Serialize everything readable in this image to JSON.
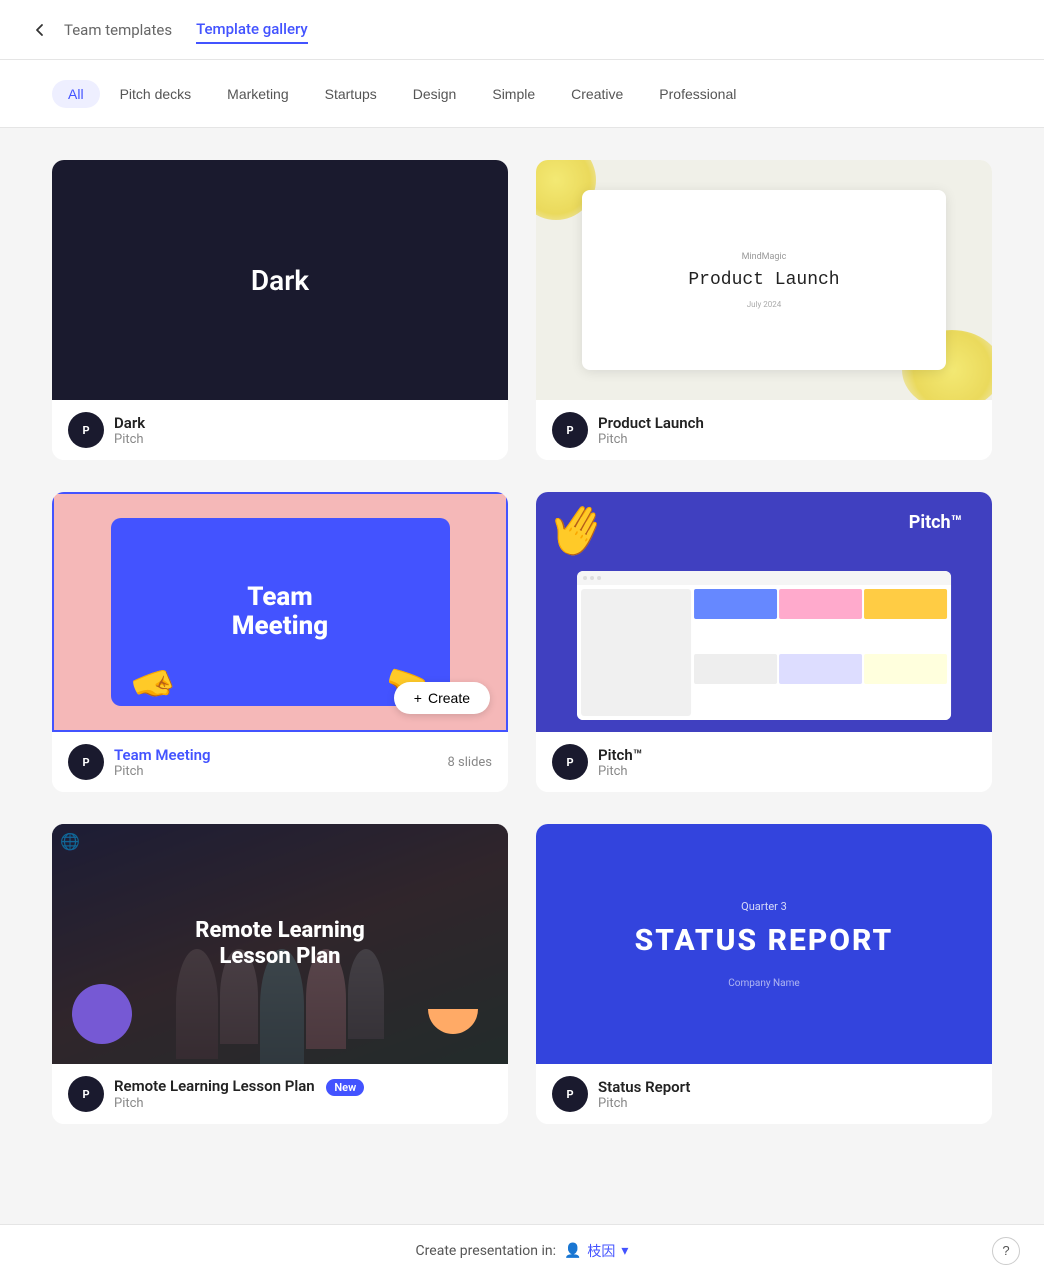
{
  "header": {
    "back_label": "←",
    "team_templates_label": "Team templates",
    "template_gallery_label": "Template gallery"
  },
  "filters": {
    "all_label": "All",
    "pitch_decks_label": "Pitch decks",
    "marketing_label": "Marketing",
    "startups_label": "Startups",
    "design_label": "Design",
    "simple_label": "Simple",
    "creative_label": "Creative",
    "professional_label": "Professional"
  },
  "templates": [
    {
      "id": "dark",
      "name": "Dark",
      "sub": "Pitch",
      "thumb_type": "dark",
      "thumb_text": "Dark",
      "slides": null,
      "is_new": false,
      "highlighted": false
    },
    {
      "id": "product-launch",
      "name": "Product Launch",
      "sub": "Pitch",
      "thumb_type": "product-launch",
      "thumb_text": "Product Launch",
      "slides": null,
      "is_new": false,
      "highlighted": false
    },
    {
      "id": "team-meeting",
      "name": "Team Meeting",
      "sub": "Pitch",
      "thumb_type": "team-meeting",
      "thumb_text": "Team\nMeeting",
      "slides": "8 slides",
      "is_new": false,
      "highlighted": true,
      "show_create": true
    },
    {
      "id": "pitch-tm",
      "name": "Pitch™",
      "sub": "Pitch",
      "thumb_type": "pitch-tm",
      "thumb_text": "Pitch™",
      "slides": null,
      "is_new": false,
      "highlighted": false
    },
    {
      "id": "remote-learning",
      "name": "Remote Learning Lesson Plan",
      "sub": "Pitch",
      "thumb_type": "remote-learning",
      "thumb_text": "Remote Learning\nLesson Plan",
      "slides": null,
      "is_new": true,
      "highlighted": false
    },
    {
      "id": "status-report",
      "name": "Status Report",
      "sub": "Pitch",
      "thumb_type": "status-report",
      "thumb_text": "STATUS REPORT",
      "slides": null,
      "is_new": false,
      "highlighted": false
    }
  ],
  "footer": {
    "create_label": "Create presentation in:",
    "language": "枝因",
    "help_label": "?"
  },
  "buttons": {
    "create_label": "+ Create",
    "new_badge": "New"
  }
}
